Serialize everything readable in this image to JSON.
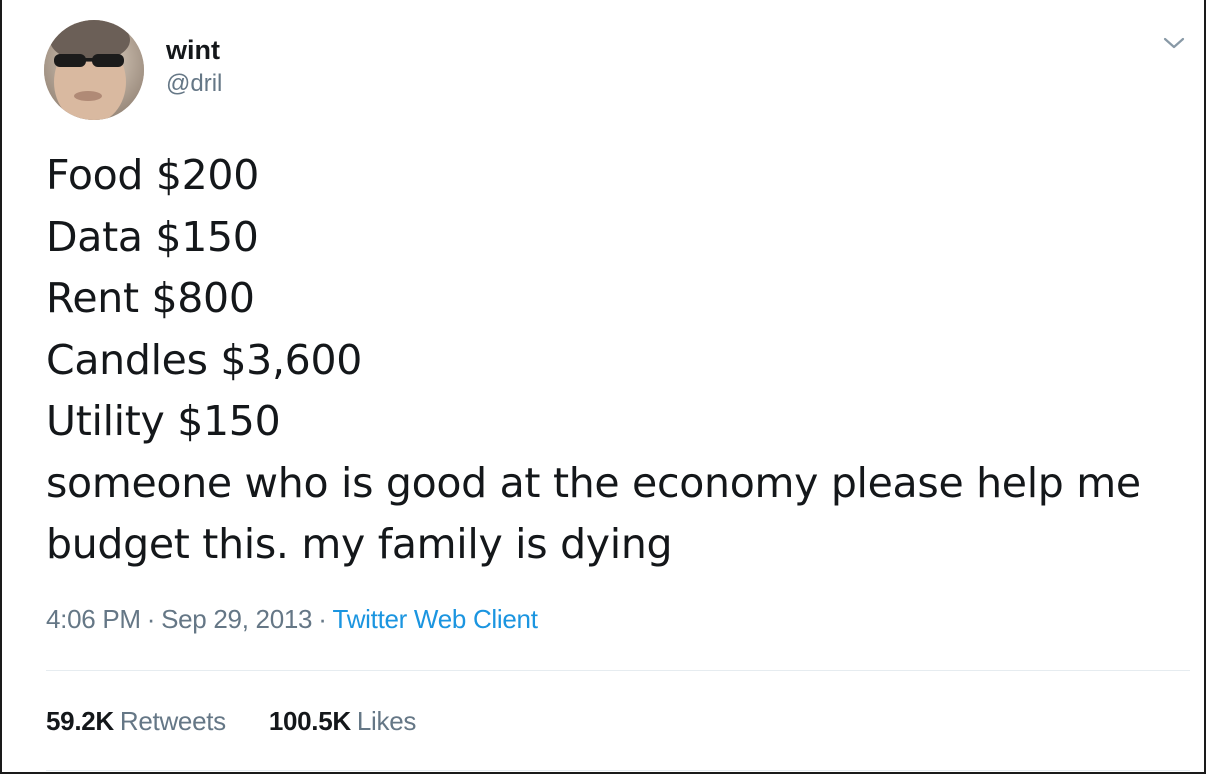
{
  "tweet": {
    "author": {
      "display_name": "wint",
      "handle": "@dril",
      "avatar_icon": "user-avatar"
    },
    "menu_icon": "chevron-down-icon",
    "text_lines": [
      "Food $200",
      "Data $150",
      "Rent $800",
      "Candles $3,600",
      "Utility $150",
      "someone who is good at the economy please help me",
      "budget this. my family is dying"
    ],
    "time": "4:06 PM",
    "date": "Sep 29, 2013",
    "separator": "·",
    "source": "Twitter Web Client",
    "stats": {
      "retweets_count": "59.2K",
      "retweets_label": "Retweets",
      "likes_count": "100.5K",
      "likes_label": "Likes"
    }
  },
  "colors": {
    "text": "#14171a",
    "secondary": "#657786",
    "link": "#1b95e0",
    "divider": "#e6ecf0"
  }
}
